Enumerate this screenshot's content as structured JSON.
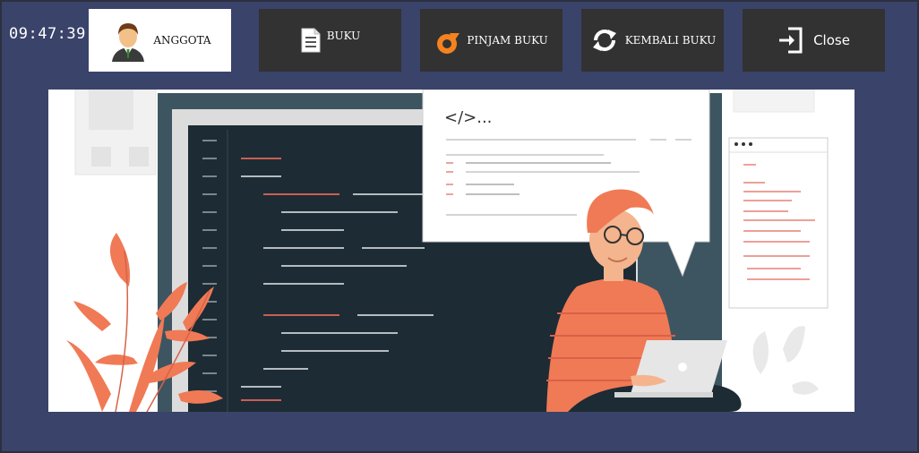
{
  "clock": {
    "time": "09:47:39"
  },
  "nav": {
    "anggota_label": "ANGGOTA",
    "buku_label": "BUKU",
    "pinjam_label": "PINJAM BUKU",
    "kembali_label": "KEMBALI BUKU",
    "close_label": "Close"
  },
  "banner": {
    "code_tag": "</>..."
  },
  "colors": {
    "background": "#3a4369",
    "button_dark": "#323232",
    "accent_orange": "#f07a55",
    "screen_dark": "#1d2b34"
  },
  "icons": {
    "anggota": "user-avatar-icon",
    "buku": "document-icon",
    "pinjam": "refresh-orange-icon",
    "kembali": "swap-arrows-icon",
    "close": "sign-in-icon"
  }
}
